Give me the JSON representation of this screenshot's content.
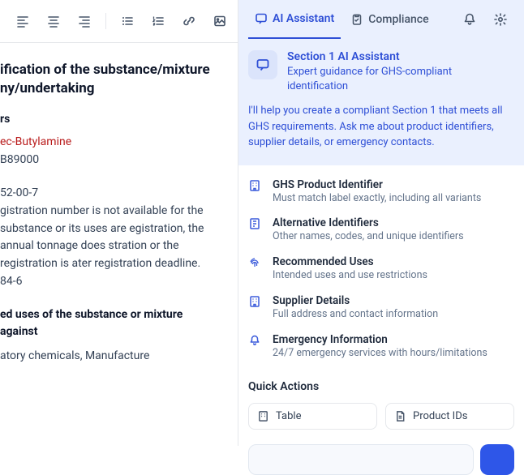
{
  "toolbar": {
    "tools": [
      "align-left",
      "align-center",
      "align-right",
      "list-bullets",
      "list-numbers",
      "link",
      "image"
    ]
  },
  "document": {
    "section_title": "ification of the substance/mixture ny/undertaking",
    "sub_rs": "rs",
    "product_name": "ec-Butylamine",
    "product_code": " B89000",
    "cas": "52-00-7",
    "reg_para": "gistration number is not available for  the substance or its uses are egistration, the annual tonnage does stration or the registration is ater registration deadline.",
    "ec": "84-6",
    "uses_h": "ed uses of the substance or mixture against",
    "uses_body": "atory chemicals, Manufacture"
  },
  "tabs": {
    "ai": "AI Assistant",
    "compliance": "Compliance"
  },
  "assistant": {
    "title": "Section 1 AI Assistant",
    "subtitle": "Expert guidance for GHS-compliant identification",
    "intro": "I'll help you create a compliant Section 1 that meets all GHS requirements. Ask me about product identifiers, supplier details, or emergency contacts."
  },
  "guides": [
    {
      "title": "GHS Product Identifier",
      "desc": "Must match label exactly, including all variants"
    },
    {
      "title": "Alternative Identifiers",
      "desc": "Other names, codes, and unique identifiers"
    },
    {
      "title": "Recommended Uses",
      "desc": "Intended uses and use restrictions"
    },
    {
      "title": "Supplier Details",
      "desc": "Full address and contact information"
    },
    {
      "title": "Emergency Information",
      "desc": "24/7 emergency services with hours/limitations"
    }
  ],
  "quick_actions": {
    "heading": "Quick Actions",
    "table": "Table",
    "product_ids": "Product IDs"
  }
}
